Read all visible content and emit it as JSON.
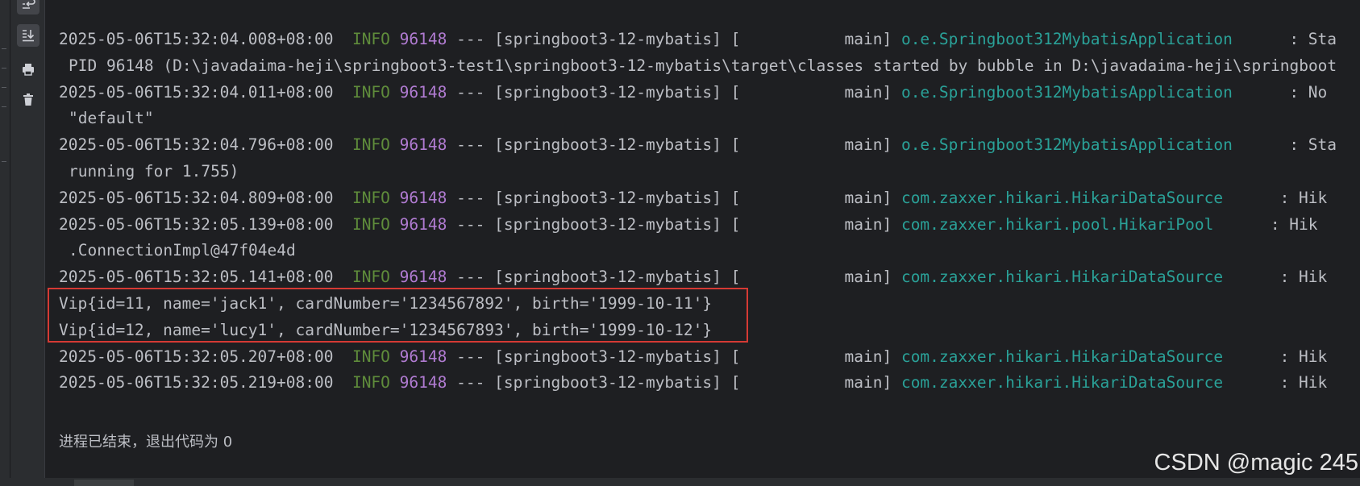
{
  "toolbar": {
    "buttons": [
      {
        "name": "soft-wrap-icon"
      },
      {
        "name": "scroll-to-end-icon"
      },
      {
        "name": "print-icon"
      },
      {
        "name": "clear-all-icon"
      }
    ]
  },
  "console": {
    "lines": [
      {
        "type": "log",
        "ts": "2025-05-06T15:32:04.008+08:00",
        "level": "INFO",
        "pid": "96148",
        "sep": "---",
        "app": "[springboot3-12-mybatis] [",
        "thread": "main]",
        "logger": "o.e.Springboot312MybatisApplication",
        "msg": ": Sta"
      },
      {
        "type": "cont",
        "text": "PID 96148 (D:\\javadaima-heji\\springboot3-test1\\springboot3-12-mybatis\\target\\classes started by bubble in D:\\javadaima-heji\\springboot"
      },
      {
        "type": "log",
        "ts": "2025-05-06T15:32:04.011+08:00",
        "level": "INFO",
        "pid": "96148",
        "sep": "---",
        "app": "[springboot3-12-mybatis] [",
        "thread": "main]",
        "logger": "o.e.Springboot312MybatisApplication",
        "msg": ": No"
      },
      {
        "type": "cont",
        "text": "\"default\""
      },
      {
        "type": "log",
        "ts": "2025-05-06T15:32:04.796+08:00",
        "level": "INFO",
        "pid": "96148",
        "sep": "---",
        "app": "[springboot3-12-mybatis] [",
        "thread": "main]",
        "logger": "o.e.Springboot312MybatisApplication",
        "msg": ": Sta"
      },
      {
        "type": "cont",
        "text": "running for 1.755)"
      },
      {
        "type": "log",
        "ts": "2025-05-06T15:32:04.809+08:00",
        "level": "INFO",
        "pid": "96148",
        "sep": "---",
        "app": "[springboot3-12-mybatis] [",
        "thread": "main]",
        "logger": "com.zaxxer.hikari.HikariDataSource",
        "msg": ": Hik"
      },
      {
        "type": "log",
        "ts": "2025-05-06T15:32:05.139+08:00",
        "level": "INFO",
        "pid": "96148",
        "sep": "---",
        "app": "[springboot3-12-mybatis] [",
        "thread": "main]",
        "logger": "com.zaxxer.hikari.pool.HikariPool",
        "msg": ": Hik"
      },
      {
        "type": "cont",
        "text": ".ConnectionImpl@47f04e4d"
      },
      {
        "type": "log",
        "ts": "2025-05-06T15:32:05.141+08:00",
        "level": "INFO",
        "pid": "96148",
        "sep": "---",
        "app": "[springboot3-12-mybatis] [",
        "thread": "main]",
        "logger": "com.zaxxer.hikari.HikariDataSource",
        "msg": ": Hik"
      },
      {
        "type": "plain",
        "text": "Vip{id=11, name='jack1', cardNumber='1234567892', birth='1999-10-11'}"
      },
      {
        "type": "plain",
        "text": "Vip{id=12, name='lucy1', cardNumber='1234567893', birth='1999-10-12'}"
      },
      {
        "type": "log",
        "ts": "2025-05-06T15:32:05.207+08:00",
        "level": "INFO",
        "pid": "96148",
        "sep": "---",
        "app": "[springboot3-12-mybatis] [",
        "thread": "main]",
        "logger": "com.zaxxer.hikari.HikariDataSource",
        "msg": ": Hik"
      },
      {
        "type": "log",
        "ts": "2025-05-06T15:32:05.219+08:00",
        "level": "INFO",
        "pid": "96148",
        "sep": "---",
        "app": "[springboot3-12-mybatis] [",
        "thread": "main]",
        "logger": "com.zaxxer.hikari.HikariDataSource",
        "msg": ": Hik"
      }
    ],
    "exit_message": "进程已结束，退出代码为 0"
  },
  "watermark": "CSDN @magic 245",
  "colors": {
    "level_info": "#5f8c3b",
    "pid": "#b07bd1",
    "logger": "#2aa198",
    "text": "#bcbec4",
    "highlight_border": "#d53a34",
    "background": "#1e1f22"
  }
}
